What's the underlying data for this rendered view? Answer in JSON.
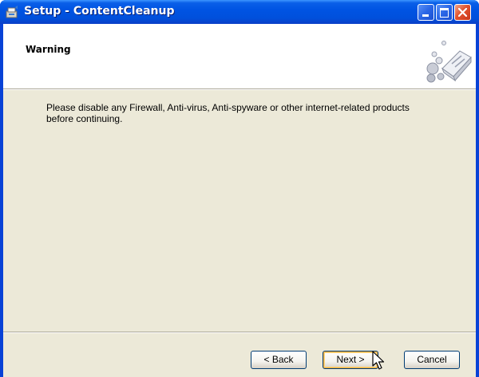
{
  "window": {
    "title": "Setup - ContentCleanup",
    "titlebar_color": "#0054e3",
    "controls": {
      "minimize_icon": "minimize-icon",
      "maximize_icon": "maximize-icon",
      "close_icon": "close-icon"
    }
  },
  "header": {
    "title": "Warning",
    "graphic_icon": "cleaner-bubbles-icon"
  },
  "body": {
    "message_line1": "Please disable any Firewall, Anti-virus, Anti-spyware or other internet-related products",
    "message_line2": "before continuing."
  },
  "buttons": {
    "back": "< Back",
    "next": "Next >",
    "cancel": "Cancel"
  },
  "colors": {
    "dialog_background": "#ece9d8",
    "header_background": "#ffffff",
    "default_button_highlight": "#f8b33e"
  }
}
